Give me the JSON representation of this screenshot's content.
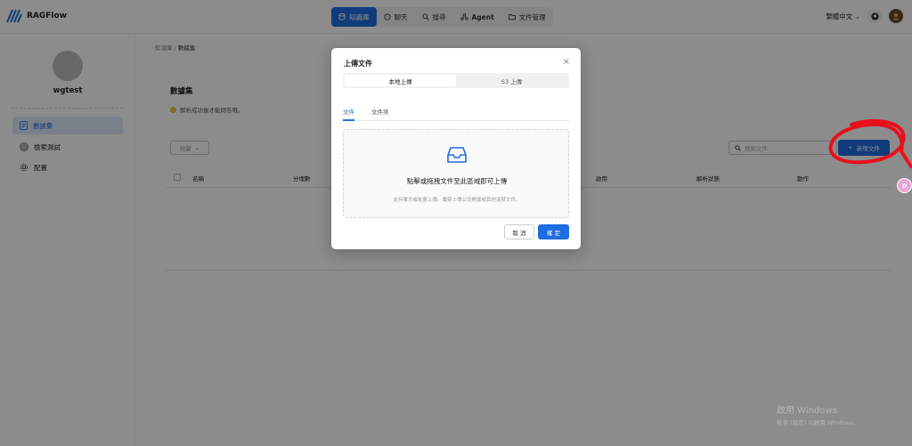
{
  "app": {
    "name": "RAGFlow"
  },
  "nav": {
    "items": [
      {
        "label": "知識庫",
        "icon": "database-icon",
        "active": true
      },
      {
        "label": "聊天",
        "icon": "chat-icon"
      },
      {
        "label": "搜尋",
        "icon": "search-icon"
      },
      {
        "label": "Agent",
        "icon": "agent-icon"
      },
      {
        "label": "文件管理",
        "icon": "folder-icon"
      }
    ]
  },
  "header": {
    "language": "繁體中文"
  },
  "sidebar": {
    "username": "wgtest",
    "items": [
      {
        "label": "數據集",
        "icon": "dataset-icon",
        "active": true
      },
      {
        "label": "檢索測試",
        "icon": "target-icon"
      },
      {
        "label": "配置",
        "icon": "gear-icon"
      }
    ]
  },
  "breadcrumb": {
    "root": "知識庫",
    "separator": "/",
    "current": "數據集"
  },
  "main": {
    "title": "數據集",
    "hint": "解析成功後才能問答哦。",
    "batch_label": "批量",
    "search_placeholder": "搜索文件",
    "new_file_label": "新增文件",
    "columns": [
      "名稱",
      "分塊數",
      "啟用",
      "解析狀態",
      "動作"
    ]
  },
  "modal": {
    "title": "上傳文件",
    "segments": [
      "本地上傳",
      "S3 上傳"
    ],
    "tabs": [
      "文件",
      "文件夾"
    ],
    "drop_text": "點擊或拖拽文件至此區域即可上傳",
    "drop_hint": "支持單次或批量上傳。嚴禁上傳公司數據或其他違禁文件。",
    "cancel_label": "取 消",
    "ok_label": "確 定"
  },
  "watermark": {
    "line1": "啟用 Windows",
    "line2": "移至 [設定] 以啟用 Windows。"
  },
  "colors": {
    "primary": "#1f6de0",
    "annotation": "#e8101a"
  }
}
